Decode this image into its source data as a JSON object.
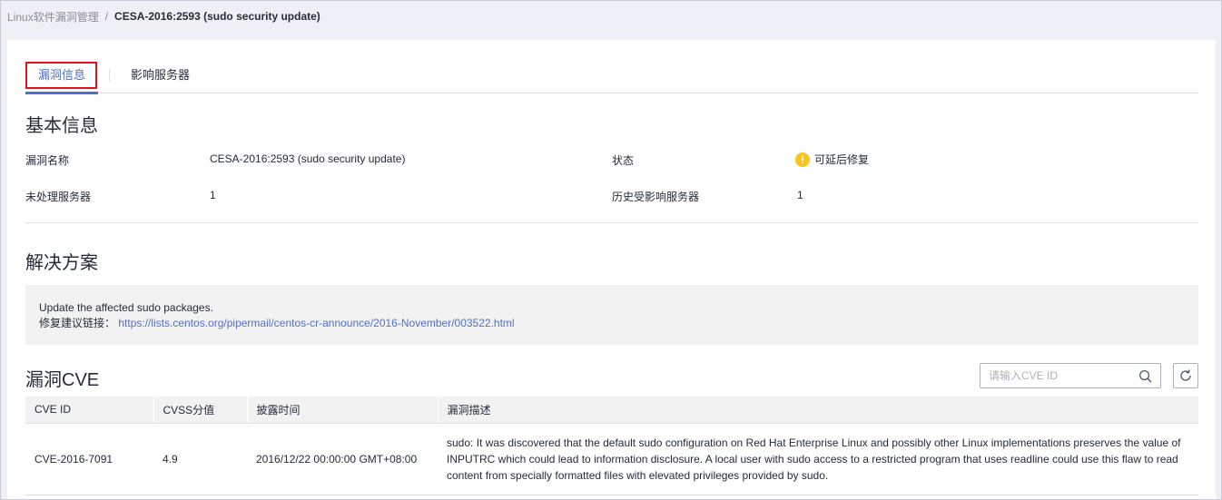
{
  "breadcrumb": {
    "parent": "Linux软件漏洞管理",
    "separator": "/",
    "current": "CESA-2016:2593 (sudo security update)"
  },
  "tabs": [
    {
      "label": "漏洞信息",
      "active": true
    },
    {
      "label": "影响服务器",
      "active": false
    }
  ],
  "basic_info": {
    "title": "基本信息",
    "name_label": "漏洞名称",
    "name_value": "CESA-2016:2593 (sudo security update)",
    "status_label": "状态",
    "status_value": "可延后修复",
    "status_icon": "warning-icon",
    "status_color": "#f7c51c",
    "unhandled_label": "未处理服务器",
    "unhandled_value": "1",
    "history_label": "历史受影响服务器",
    "history_value": "1"
  },
  "solution": {
    "title": "解决方案",
    "text": "Update the affected sudo packages.",
    "link_label": "修复建议链接：",
    "link_url": "https://lists.centos.org/pipermail/centos-cr-announce/2016-November/003522.html"
  },
  "cve": {
    "title": "漏洞CVE",
    "search_placeholder": "请输入CVE ID",
    "columns": [
      "CVE ID",
      "CVSS分值",
      "披露时间",
      "漏洞描述"
    ],
    "rows": [
      {
        "id": "CVE-2016-7091",
        "cvss": "4.9",
        "disclosed": "2016/12/22 00:00:00 GMT+08:00",
        "description": "sudo: It was discovered that the default sudo configuration on Red Hat Enterprise Linux and possibly other Linux implementations preserves the value of INPUTRC which could lead to information disclosure. A local user with sudo access to a restricted program that uses readline could use this flaw to read content from specially formatted files with elevated privileges provided by sudo."
      }
    ]
  },
  "colors": {
    "accent": "#526ecc",
    "highlight_box": "#e1121b",
    "text": "#252b3a",
    "muted": "#8a8e99"
  }
}
